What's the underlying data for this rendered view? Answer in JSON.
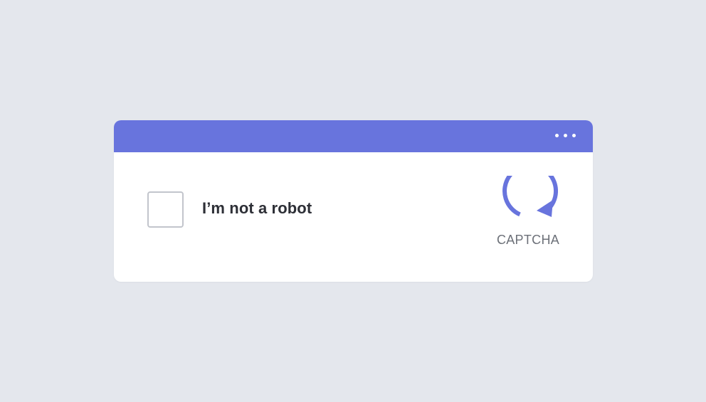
{
  "widget": {
    "header": {
      "menu_icon": "more-horizontal-icon",
      "color": "#6874dd"
    },
    "checkbox": {
      "checked": false
    },
    "label": "I’m not a robot",
    "logo": {
      "icon": "refresh-arrow-icon",
      "color": "#6874dd",
      "text": "CAPTCHA"
    }
  }
}
